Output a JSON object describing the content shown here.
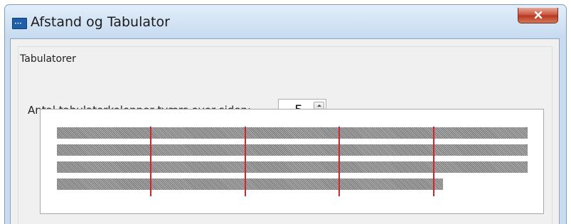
{
  "window": {
    "title": "Afstand og Tabulator"
  },
  "group": {
    "title": "Tabulatorer"
  },
  "tab_columns": {
    "label": "Antal tabulatorkolonner tværs over siden:",
    "value": "5"
  },
  "preview": {
    "tab_columns": 5,
    "lines": [
      {
        "fill_fraction": 1.0
      },
      {
        "fill_fraction": 1.0
      },
      {
        "fill_fraction": 1.0
      },
      {
        "fill_fraction": 0.82
      }
    ]
  },
  "colors": {
    "tab_stop": "#d8232a",
    "text_placeholder": "#909090"
  },
  "icons": {
    "app": "dialog-app-icon",
    "close": "close-icon"
  }
}
